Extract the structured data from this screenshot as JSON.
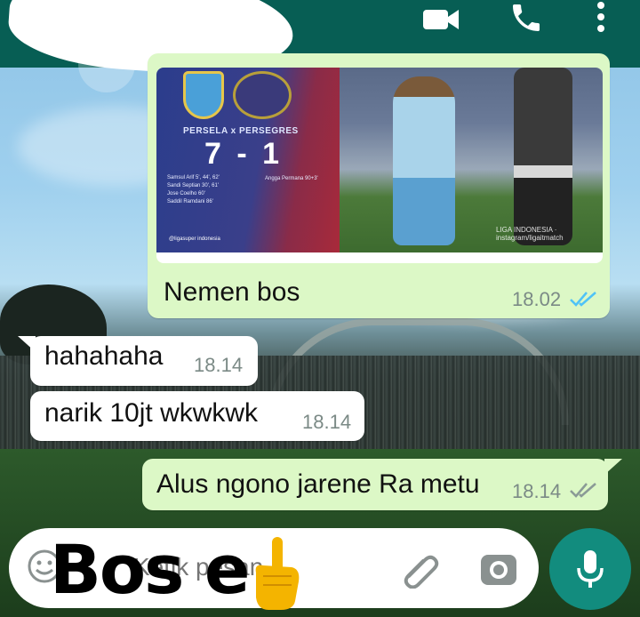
{
  "chat": {
    "contact_name": "",
    "header_icons": [
      "video-call-icon",
      "voice-call-icon",
      "more-options-icon"
    ]
  },
  "image_message": {
    "match_title": "PERSELA x PERSEGRES",
    "score": "7 - 1",
    "home_scorers": [
      "Samsul Arif 5', 44', 62'",
      "Sandi Septian 30', 61'",
      "Jose Coelho 60'",
      "Saddil Ramdani 86'"
    ],
    "away_scorers": "Angga Permana 90+3'",
    "instagram_handle": "@ligasuper indonesia",
    "watermark": "LIGA INDONESIA · instagram/ligaitmatch"
  },
  "messages": [
    {
      "direction": "out",
      "text": "Nemen bos",
      "time": "18.02",
      "status": "read"
    },
    {
      "direction": "in",
      "text": "hahahaha",
      "time": "18.14"
    },
    {
      "direction": "in",
      "text": "narik 10jt wkwkwk",
      "time": "18.14"
    },
    {
      "direction": "out",
      "text": "Alus ngono jarene Ra metu",
      "time": "18.14",
      "status": "delivered"
    }
  ],
  "input": {
    "placeholder": "Ketik pesan"
  },
  "caption": {
    "text": "Bos e",
    "emoji": "pointing-up-hand"
  },
  "colors": {
    "header": "#075e54",
    "outgoing_bubble": "#dcf8c6",
    "incoming_bubble": "#ffffff",
    "read_ticks": "#4fc3f7",
    "mic_button": "#128c7e"
  }
}
